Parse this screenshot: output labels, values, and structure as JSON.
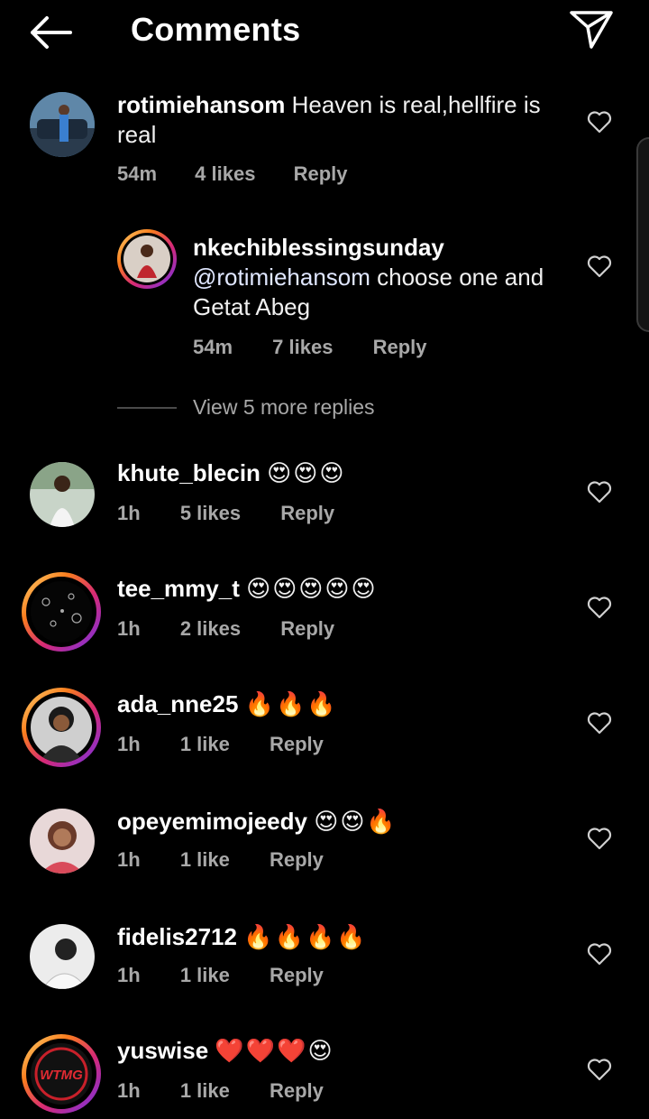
{
  "header": {
    "title": "Comments",
    "back_icon": "arrow-left-icon",
    "share_icon": "paper-plane-icon"
  },
  "comments": [
    {
      "username": "rotimiehansom",
      "text": "Heaven is real,hellfire is real",
      "time": "54m",
      "likes": "4 likes",
      "reply": "Reply"
    },
    {
      "username": "nkechiblessingsunday",
      "mention": "@rotimiehansom",
      "text": "choose one and Getat Abeg",
      "time": "54m",
      "likes": "7 likes",
      "reply": "Reply"
    },
    {
      "username": "khute_blecin",
      "text": "😍😍😍",
      "time": "1h",
      "likes": "5 likes",
      "reply": "Reply"
    },
    {
      "username": "tee_mmy_t",
      "text": "😍😍😍😍😍",
      "time": "1h",
      "likes": "2 likes",
      "reply": "Reply"
    },
    {
      "username": "ada_nne25",
      "text": "🔥🔥🔥",
      "time": "1h",
      "likes": "1 like",
      "reply": "Reply"
    },
    {
      "username": "opeyemimojeedy",
      "text": "😍😍🔥",
      "time": "1h",
      "likes": "1 like",
      "reply": "Reply"
    },
    {
      "username": "fidelis2712",
      "text": "🔥🔥🔥🔥",
      "time": "1h",
      "likes": "1 like",
      "reply": "Reply"
    },
    {
      "username": "yuswise",
      "text": "❤️❤️❤️😍",
      "time": "1h",
      "likes": "1 like",
      "reply": "Reply"
    }
  ],
  "view_more": "View 5 more replies",
  "avatar_logo_text": "WTMG",
  "colors": {
    "background": "#000000",
    "meta": "#a8a8a8",
    "story_ring_start": "#feda75",
    "story_ring_end": "#962fbf"
  }
}
